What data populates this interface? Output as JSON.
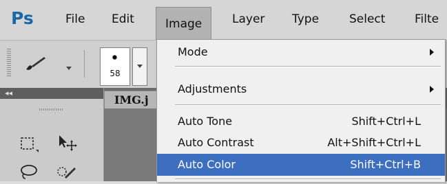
{
  "app": {
    "logo": "Ps"
  },
  "menubar": {
    "items": [
      "File",
      "Edit",
      "Image",
      "Layer",
      "Type",
      "Select",
      "Filte"
    ],
    "active": "Image"
  },
  "options": {
    "brush_size": "58",
    "tool_icon": "brush-icon"
  },
  "document": {
    "tab_title": "IMG.j"
  },
  "image_menu": {
    "items": [
      {
        "label": "Mode",
        "shortcut": "",
        "submenu": true
      },
      {
        "label": "Adjustments",
        "shortcut": "",
        "submenu": true
      },
      {
        "label": "Auto Tone",
        "shortcut": "Shift+Ctrl+L",
        "submenu": false
      },
      {
        "label": "Auto Contrast",
        "shortcut": "Alt+Shift+Ctrl+L",
        "submenu": false
      },
      {
        "label": "Auto Color",
        "shortcut": "Shift+Ctrl+B",
        "submenu": false,
        "highlighted": true
      }
    ]
  },
  "colors": {
    "logo": "#1b67a8",
    "highlight": "#3d6fc1",
    "menu_bg": "#f0f0f0"
  }
}
